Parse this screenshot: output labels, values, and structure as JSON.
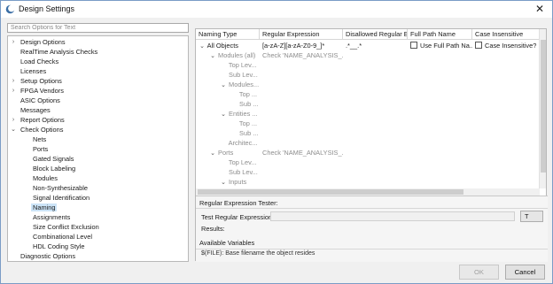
{
  "window": {
    "title": "Design Settings",
    "close_glyph": "✕"
  },
  "search": {
    "placeholder": "Search Options for Text"
  },
  "tree": [
    {
      "label": "Design Options",
      "arrow": "›",
      "level": 0,
      "selected": false
    },
    {
      "label": "RealTime Analysis Checks",
      "arrow": "",
      "level": 0,
      "selected": false
    },
    {
      "label": "Load Checks",
      "arrow": "",
      "level": 0,
      "selected": false
    },
    {
      "label": "Licenses",
      "arrow": "",
      "level": 0,
      "selected": false
    },
    {
      "label": "Setup Options",
      "arrow": "›",
      "level": 0,
      "selected": false
    },
    {
      "label": "FPGA Vendors",
      "arrow": "›",
      "level": 0,
      "selected": false
    },
    {
      "label": "ASIC Options",
      "arrow": "",
      "level": 0,
      "selected": false
    },
    {
      "label": "Messages",
      "arrow": "",
      "level": 0,
      "selected": false
    },
    {
      "label": "Report Options",
      "arrow": "›",
      "level": 0,
      "selected": false
    },
    {
      "label": "Check Options",
      "arrow": "⌄",
      "level": 0,
      "selected": false
    },
    {
      "label": "Nets",
      "arrow": "",
      "level": 1,
      "selected": false
    },
    {
      "label": "Ports",
      "arrow": "",
      "level": 1,
      "selected": false
    },
    {
      "label": "Gated Signals",
      "arrow": "",
      "level": 1,
      "selected": false
    },
    {
      "label": "Block Labeling",
      "arrow": "",
      "level": 1,
      "selected": false
    },
    {
      "label": "Modules",
      "arrow": "",
      "level": 1,
      "selected": false
    },
    {
      "label": "Non-Synthesizable",
      "arrow": "",
      "level": 1,
      "selected": false
    },
    {
      "label": "Signal Identification",
      "arrow": "",
      "level": 1,
      "selected": false
    },
    {
      "label": "Naming",
      "arrow": "",
      "level": 1,
      "selected": true
    },
    {
      "label": "Assignments",
      "arrow": "",
      "level": 1,
      "selected": false
    },
    {
      "label": "Size Conflict Exclusion",
      "arrow": "",
      "level": 1,
      "selected": false
    },
    {
      "label": "Combinational Level",
      "arrow": "",
      "level": 1,
      "selected": false
    },
    {
      "label": "HDL Coding Style",
      "arrow": "",
      "level": 1,
      "selected": false
    },
    {
      "label": "Diagnostic Options",
      "arrow": "",
      "level": 0,
      "selected": false
    }
  ],
  "grid": {
    "columns": [
      "Naming Type",
      "Regular Expression",
      "Disallowed Regular E",
      "Full Path Name",
      "Case Insensitive"
    ],
    "rows": [
      {
        "toggle": "⌄",
        "indent": 0,
        "name": "All Objects",
        "dim": false,
        "regex": "[a-zA-Z][a-zA-Z0-9_]*",
        "disallowed": ".*__.*",
        "fullpath": "Use Full Path Na...",
        "caseins": "Case Insensitive?"
      },
      {
        "toggle": "⌄",
        "indent": 1,
        "name": "Modules (all)",
        "dim": true,
        "regex": "Check 'NAME_ANALYSIS_...",
        "disallowed": "",
        "fullpath": "",
        "caseins": ""
      },
      {
        "toggle": "",
        "indent": 2,
        "name": "Top Lev...",
        "dim": true,
        "regex": "",
        "disallowed": "",
        "fullpath": "",
        "caseins": ""
      },
      {
        "toggle": "",
        "indent": 2,
        "name": "Sub Lev...",
        "dim": true,
        "regex": "",
        "disallowed": "",
        "fullpath": "",
        "caseins": ""
      },
      {
        "toggle": "⌄",
        "indent": 2,
        "name": "Modules...",
        "dim": true,
        "regex": "",
        "disallowed": "",
        "fullpath": "",
        "caseins": ""
      },
      {
        "toggle": "",
        "indent": 3,
        "name": "Top ...",
        "dim": true,
        "regex": "",
        "disallowed": "",
        "fullpath": "",
        "caseins": ""
      },
      {
        "toggle": "",
        "indent": 3,
        "name": "Sub ...",
        "dim": true,
        "regex": "",
        "disallowed": "",
        "fullpath": "",
        "caseins": ""
      },
      {
        "toggle": "⌄",
        "indent": 2,
        "name": "Entities ...",
        "dim": true,
        "regex": "",
        "disallowed": "",
        "fullpath": "",
        "caseins": ""
      },
      {
        "toggle": "",
        "indent": 3,
        "name": "Top ...",
        "dim": true,
        "regex": "",
        "disallowed": "",
        "fullpath": "",
        "caseins": ""
      },
      {
        "toggle": "",
        "indent": 3,
        "name": "Sub ...",
        "dim": true,
        "regex": "",
        "disallowed": "",
        "fullpath": "",
        "caseins": ""
      },
      {
        "toggle": "",
        "indent": 2,
        "name": "Architec...",
        "dim": true,
        "regex": "",
        "disallowed": "",
        "fullpath": "",
        "caseins": ""
      },
      {
        "toggle": "⌄",
        "indent": 1,
        "name": "Ports",
        "dim": true,
        "regex": "Check 'NAME_ANALYSIS_...",
        "disallowed": "",
        "fullpath": "",
        "caseins": ""
      },
      {
        "toggle": "",
        "indent": 2,
        "name": "Top Lev...",
        "dim": true,
        "regex": "",
        "disallowed": "",
        "fullpath": "",
        "caseins": ""
      },
      {
        "toggle": "",
        "indent": 2,
        "name": "Sub Lev...",
        "dim": true,
        "regex": "",
        "disallowed": "",
        "fullpath": "",
        "caseins": ""
      },
      {
        "toggle": "⌄",
        "indent": 2,
        "name": "Inputs",
        "dim": true,
        "regex": "",
        "disallowed": "",
        "fullpath": "",
        "caseins": ""
      }
    ]
  },
  "tester": {
    "title": "Regular Expression Tester:",
    "expr_label": "Test Regular Expression:",
    "test_button": "T",
    "results_label": "Results:",
    "vars_label": "Available Variables",
    "vars_text": "$(FILE): Base filename the object resides"
  },
  "buttons": {
    "ok": "OK",
    "cancel": "Cancel"
  },
  "icons": {
    "app": "moon-logo-icon",
    "close": "close-icon"
  }
}
